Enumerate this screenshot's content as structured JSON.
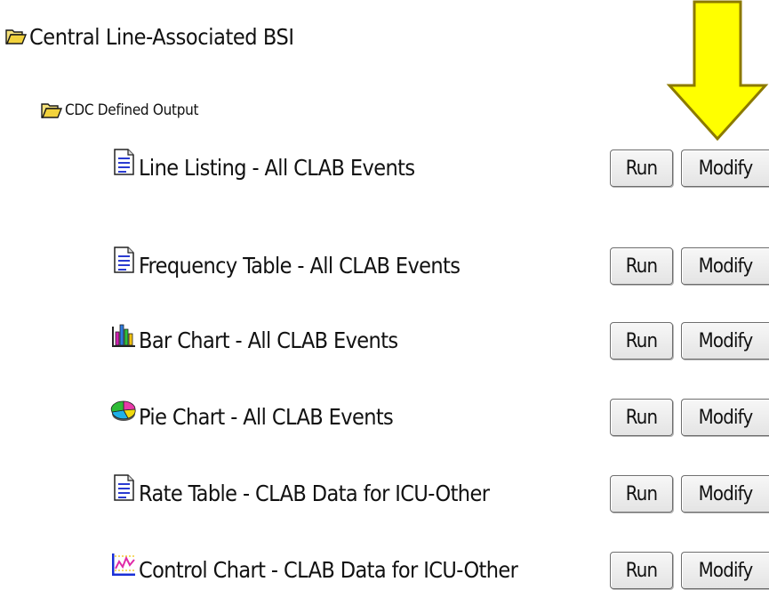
{
  "tree": {
    "root": {
      "label": "Central Line-Associated BSI",
      "icon": "open-folder-icon"
    },
    "group": {
      "label": "CDC Defined Output",
      "icon": "open-folder-icon"
    },
    "items": [
      {
        "label": "Line Listing - All CLAB Events",
        "icon": "document-icon",
        "run_label": "Run",
        "modify_label": "Modify"
      },
      {
        "label": "Frequency Table - All CLAB Events",
        "icon": "document-icon",
        "run_label": "Run",
        "modify_label": "Modify"
      },
      {
        "label": "Bar Chart - All CLAB Events",
        "icon": "bar-chart-icon",
        "run_label": "Run",
        "modify_label": "Modify"
      },
      {
        "label": "Pie Chart - All CLAB Events",
        "icon": "pie-chart-icon",
        "run_label": "Run",
        "modify_label": "Modify"
      },
      {
        "label": "Rate Table - CLAB Data for ICU-Other",
        "icon": "document-icon",
        "run_label": "Run",
        "modify_label": "Modify"
      },
      {
        "label": "Control Chart - CLAB Data for ICU-Other",
        "icon": "control-chart-icon",
        "run_label": "Run",
        "modify_label": "Modify"
      }
    ]
  },
  "annotation": {
    "icon": "down-arrow-icon",
    "color": "#ffff00",
    "outline": "#8c7a00"
  }
}
